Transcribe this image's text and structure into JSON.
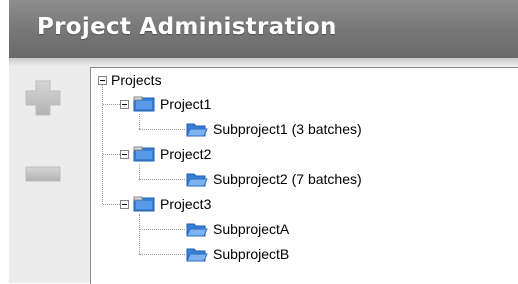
{
  "header": {
    "title": "Project Administration"
  },
  "actions": {
    "add_icon": "plus-icon",
    "remove_icon": "minus-icon"
  },
  "tree": {
    "root": {
      "label": "Projects"
    },
    "projects": [
      {
        "label": "Project1",
        "children": [
          {
            "label": "Subproject1 (3 batches)"
          }
        ]
      },
      {
        "label": "Project2",
        "children": [
          {
            "label": "Subproject2 (7 batches)"
          }
        ]
      },
      {
        "label": "Project3",
        "children": [
          {
            "label": "SubprojectA"
          },
          {
            "label": "SubprojectB"
          }
        ]
      }
    ]
  },
  "colors": {
    "header_bg": "#7a7a7a",
    "panel_bg": "#ececec",
    "folder_blue": "#3a7fd6",
    "button_gray": "#c4c4c4"
  }
}
